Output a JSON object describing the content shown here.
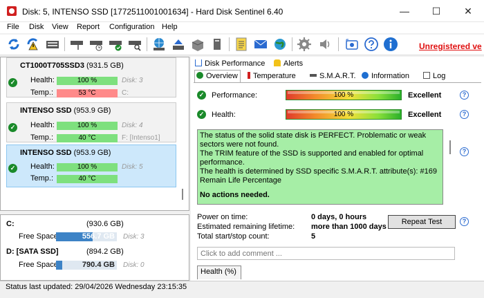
{
  "window": {
    "title": "Disk: 5, INTENSO SSD [1772511001001634]  -  Hard Disk Sentinel 6.40",
    "minimize_label": "—",
    "maximize_label": "☐",
    "close_label": "✕"
  },
  "menu": [
    "File",
    "Disk",
    "View",
    "Report",
    "Configuration",
    "Help"
  ],
  "toolbar": {
    "unregistered_label": "Unregistered ve"
  },
  "disks": [
    {
      "name": "CT1000T705SSD3",
      "size": "(931.5 GB)",
      "health_label": "Health:",
      "health": "100 %",
      "temp_label": "Temp.:",
      "temp": "53 °C",
      "disk_label": "Disk: 3",
      "volume_label": "C:"
    },
    {
      "name": "INTENSO SSD",
      "size": "(953.9 GB)",
      "health_label": "Health:",
      "health": "100 %",
      "temp_label": "Temp.:",
      "temp": "40 °C",
      "disk_label": "Disk: 4",
      "volume_label": "F: [Intenso1]"
    },
    {
      "name": "INTENSO SSD",
      "size": "(953.9 GB)",
      "health_label": "Health:",
      "health": "100 %",
      "temp_label": "Temp.:",
      "temp": "40 °C",
      "disk_label": "Disk: 5",
      "volume_label": ""
    }
  ],
  "volumes": [
    {
      "name": "C:",
      "size": "(930.6 GB)",
      "free_label": "Free Space",
      "free": "556.7 GB",
      "free_fraction": 0.6,
      "disk_label": "Disk: 3"
    },
    {
      "name": "D: [SATA SSD]",
      "size": "(894.2 GB)",
      "free_label": "Free Space",
      "free": "790.4 GB",
      "free_fraction": 0.1,
      "disk_label": "Disk: 0"
    }
  ],
  "tabs_row1": [
    "Disk Performance",
    "Alerts"
  ],
  "tabs_row2": [
    "Overview",
    "Temperature",
    "S.M.A.R.T.",
    "Information",
    "Log"
  ],
  "overview": {
    "performance_label": "Performance:",
    "performance_value": "100 %",
    "performance_rating": "Excellent",
    "health_label": "Health:",
    "health_value": "100 %",
    "health_rating": "Excellent",
    "help_label": "?",
    "summary_lines": [
      "The status of the solid state disk is PERFECT. Problematic or weak sectors were not found.",
      "The TRIM feature of the SSD is supported and enabled for optimal performance.",
      "The health is determined by SSD specific S.M.A.R.T. attribute(s):  #169 Remain Life Percentage"
    ],
    "summary_action": "No actions needed.",
    "power_on_label": "Power on time:",
    "power_on_value": "0 days, 0 hours",
    "lifetime_label": "Estimated remaining lifetime:",
    "lifetime_value": "more than 1000 days",
    "startstop_label": "Total start/stop count:",
    "startstop_value": "5",
    "repeat_test_label": "Repeat Test",
    "comment_placeholder": "Click to add comment ...",
    "health_history_label": "Health (%)"
  },
  "status": {
    "text": "Status last updated: 29/04/2026 Wednesday 23:15:35"
  },
  "colors": {
    "ok_green": "#1a8a2a",
    "summary_bg": "#a6eea6",
    "unregistered_red": "#e01010"
  }
}
